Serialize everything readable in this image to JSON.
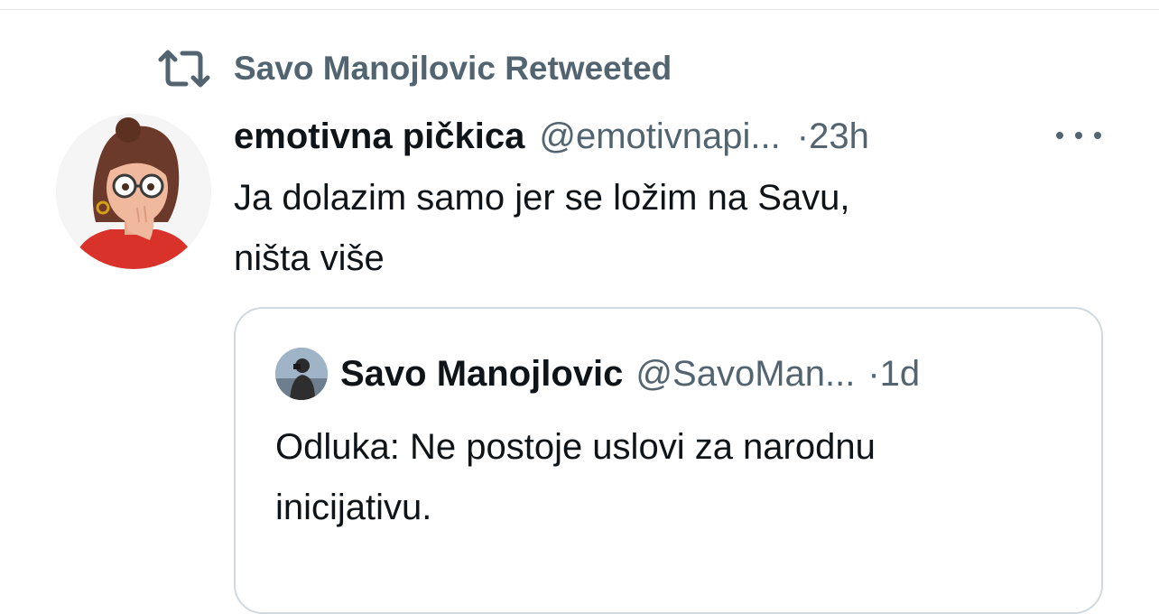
{
  "retweet": {
    "label": "Savo Manojlovic Retweeted",
    "icon": "retweet-icon"
  },
  "tweet": {
    "author_name": "emotivna pičkica",
    "author_handle": "@emotivnapi...",
    "time": "·23h",
    "more_icon": "more-dots-icon",
    "text_line1": "Ja dolazim samo jer se ložim na Savu,",
    "text_line2": "ništa više",
    "avatar": "memoji-avatar"
  },
  "quote": {
    "author_name": "Savo Manojlovic",
    "author_handle": "@SavoMan...",
    "time": "·1d",
    "text_line1": "Odluka: Ne postoje uslovi za narodnu",
    "text_line2": "inicijativu.",
    "avatar": "photo-avatar"
  },
  "colors": {
    "text_primary": "#0f1419",
    "text_secondary": "#536471",
    "border": "#cfd9de",
    "background": "#ffffff"
  }
}
